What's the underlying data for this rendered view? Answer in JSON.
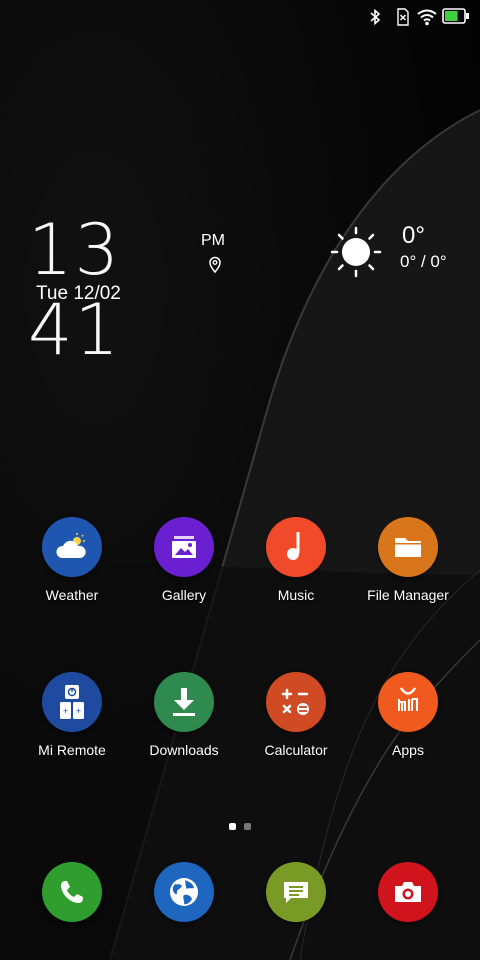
{
  "status_bar": {
    "icons": [
      "bluetooth-icon",
      "sim-none-icon",
      "wifi-icon",
      "battery-icon"
    ],
    "battery_level": 0.7,
    "battery_color": "#3fcf3f"
  },
  "clock": {
    "time": "13 41",
    "ampm": "PM",
    "date": "Tue 12/02"
  },
  "weather": {
    "icon": "sun-icon",
    "temp": "0°",
    "range": "0° / 0°"
  },
  "apps": [
    {
      "label": "Weather",
      "icon": "cloud-sun-icon",
      "color": "#1e56b0"
    },
    {
      "label": "Gallery",
      "icon": "gallery-icon",
      "color": "#6a1fd0"
    },
    {
      "label": "Music",
      "icon": "music-note-icon",
      "color": "#f04a2a"
    },
    {
      "label": "File Manager",
      "icon": "folder-icon",
      "color": "#d9751a"
    },
    {
      "label": "Mi Remote",
      "icon": "remote-icon",
      "color": "#1e4aa0"
    },
    {
      "label": "Downloads",
      "icon": "download-icon",
      "color": "#2f8a4f"
    },
    {
      "label": "Calculator",
      "icon": "calculator-icon",
      "color": "#d04a24"
    },
    {
      "label": "Apps",
      "icon": "mi-bag-icon",
      "color": "#f05a1e"
    }
  ],
  "page_indicator": {
    "pages": 2,
    "current": 1
  },
  "dock": [
    {
      "icon": "phone-icon",
      "color": "#2f9e2f"
    },
    {
      "icon": "browser-globe-icon",
      "color": "#1e66c0"
    },
    {
      "icon": "messages-icon",
      "color": "#7a9a26"
    },
    {
      "icon": "camera-icon",
      "color": "#d0141e"
    }
  ]
}
